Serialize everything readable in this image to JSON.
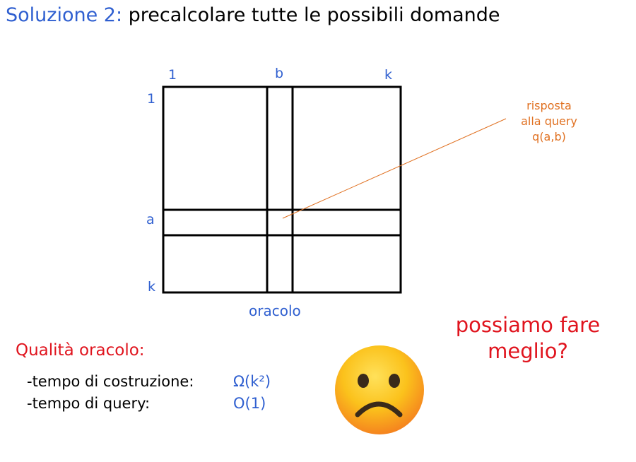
{
  "title": {
    "prefix": "Soluzione 2:",
    "text": "precalcolare tutte le possibili domande"
  },
  "matrix": {
    "top_labels": [
      "1",
      "b",
      "k"
    ],
    "left_labels": [
      "1",
      "a",
      "k"
    ],
    "caption": "oracolo"
  },
  "annotation": {
    "lines": [
      "risposta",
      "alla query",
      "q(a,b)"
    ],
    "color": "#e07020"
  },
  "quality": {
    "heading": "Qualità oracolo:",
    "rows": [
      {
        "label": "-tempo di costruzione:",
        "value": "Ω(k²)"
      },
      {
        "label": "-tempo di query:",
        "value": "O(1)"
      }
    ]
  },
  "question": {
    "lines": [
      "possiamo fare",
      "meglio?"
    ],
    "color": "#e0141e"
  },
  "face": {
    "icon": "sad-face-icon"
  },
  "colors": {
    "accent": "#2f5fd0",
    "line": "#000000"
  }
}
